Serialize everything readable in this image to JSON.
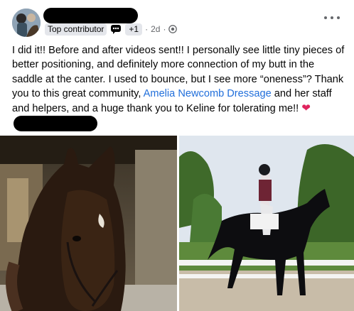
{
  "post": {
    "author": {
      "badge": "Top contributor",
      "plus_count": "+1",
      "time": "2d"
    },
    "text": {
      "part1": "I did it!! Before and after videos sent!! I personally see little tiny pieces of better positioning, and definitely more connection of my butt in the saddle at the canter. I used to bounce, but I see more “oneness”? Thank you to this great community, ",
      "mention": "Amelia Newcomb Dressage",
      "part2": " and her staff and helpers, and a huge thank you to Keline for tolerating me!! "
    },
    "icons": {
      "badge_icon": "chat-badge-icon",
      "privacy_icon": "globe-icon",
      "menu_icon": "more-options-icon",
      "reaction_icon": "red-heart-emoji"
    },
    "colors": {
      "link": "#216fdb",
      "meta_text": "#65676b",
      "badge_bg": "#e4e6eb"
    }
  }
}
